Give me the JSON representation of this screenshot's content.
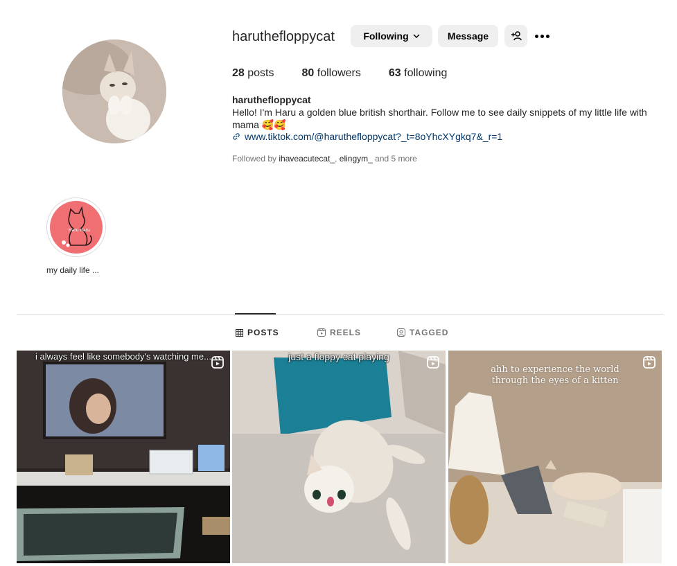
{
  "profile": {
    "username": "haruthefloppycat",
    "following_button": "Following",
    "message_button": "Message",
    "stats": {
      "posts_count": "28",
      "posts_label": "posts",
      "followers_count": "80",
      "followers_label": "followers",
      "following_count": "63",
      "following_label": "following"
    },
    "bio": {
      "name": "haruthefloppycat",
      "text": "Hello! I'm Haru a golden blue british shorthair. Follow me to see daily snippets of my little life with mama 🥰🥰",
      "link": "www.tiktok.com/@haruthefloppycat?_t=8oYhcXYgkq7&_r=1"
    },
    "followed_by": {
      "prefix": "Followed by",
      "user1": "ihaveacutecat_",
      "user2": "elingym_",
      "suffix": "and 5 more"
    }
  },
  "highlights": [
    {
      "label": "my daily life ...",
      "badge_text": "Haru Haru"
    }
  ],
  "tabs": [
    {
      "label": "POSTS",
      "icon": "grid-icon",
      "active": true
    },
    {
      "label": "REELS",
      "icon": "reels-icon",
      "active": false
    },
    {
      "label": "TAGGED",
      "icon": "tagged-icon",
      "active": false
    }
  ],
  "posts": [
    {
      "caption": "i always feel like somebody's watching me...",
      "type": "reel"
    },
    {
      "caption": "just a floppy cat playing",
      "type": "reel"
    },
    {
      "caption_line1": "ahh to experience the world",
      "caption_line2": "through the eyes of a kitten",
      "type": "reel"
    }
  ],
  "colors": {
    "accent_link": "#00376b",
    "highlight_bg": "#f06f73",
    "button_bg": "#efefef"
  }
}
